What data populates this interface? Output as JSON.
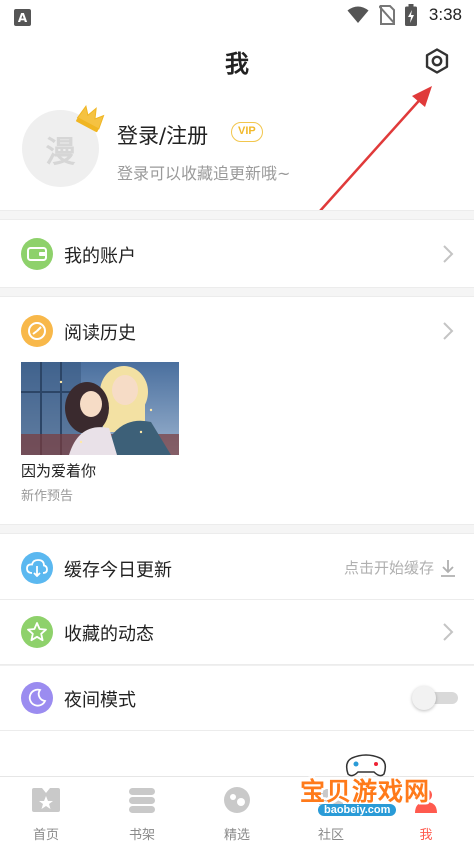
{
  "status_bar": {
    "app_badge": "A",
    "time": "3:38",
    "icons": [
      "wifi-icon",
      "no-sim-icon",
      "battery-charging-icon"
    ]
  },
  "header": {
    "title": "我",
    "settings_icon": "gear-icon"
  },
  "profile": {
    "avatar_text": "漫",
    "login_label": "登录/注册",
    "vip_label": "VIP",
    "subtitle": "登录可以收藏追更新哦~"
  },
  "menu": {
    "account": {
      "label": "我的账户",
      "icon": "wallet-icon",
      "color": "#8ed16b"
    },
    "history": {
      "label": "阅读历史",
      "icon": "clock-icon",
      "color": "#f8b84a"
    },
    "cache": {
      "label": "缓存今日更新",
      "icon": "cloud-download-icon",
      "color": "#5bb8f0",
      "action": "点击开始缓存"
    },
    "favorites": {
      "label": "收藏的动态",
      "icon": "star-icon",
      "color": "#8ed16b"
    },
    "night_mode": {
      "label": "夜间模式",
      "icon": "moon-icon",
      "color": "#9b8cf0",
      "enabled": false
    }
  },
  "history_items": [
    {
      "title": "因为爱着你",
      "subtitle": "新作预告"
    }
  ],
  "bottom_nav": {
    "items": [
      {
        "label": "首页",
        "icon": "home-icon"
      },
      {
        "label": "书架",
        "icon": "bookshelf-icon"
      },
      {
        "label": "精选",
        "icon": "featured-icon"
      },
      {
        "label": "社区",
        "icon": "community-icon"
      },
      {
        "label": "我",
        "icon": "me-icon"
      }
    ],
    "active_color": "#ff5a4e"
  },
  "watermark": {
    "text": "宝贝游戏网",
    "url": "baobeiy.com"
  }
}
